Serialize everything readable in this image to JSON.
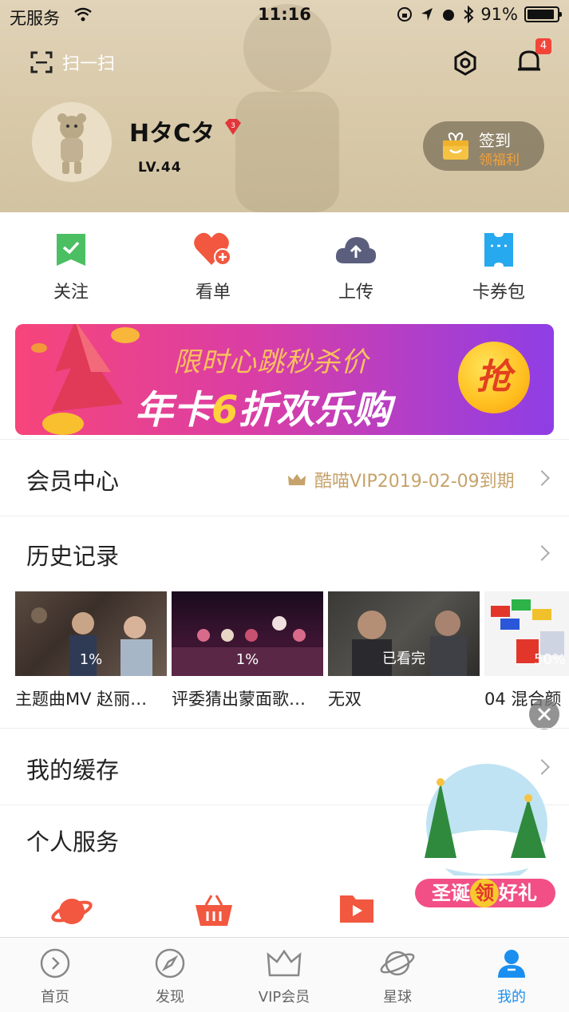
{
  "status_bar": {
    "carrier": "无服务",
    "time": "11:16",
    "battery": "91%",
    "battery_level": 0.91
  },
  "header": {
    "scan_label": "扫一扫",
    "notification_count": "4",
    "username": "HタCタ",
    "vip_badge_level": "3",
    "level": "LV.44",
    "checkin_label": "签到",
    "checkin_sub": "领福利"
  },
  "quick_actions": [
    {
      "label": "关注",
      "icon": "follow-icon"
    },
    {
      "label": "看单",
      "icon": "watchlist-icon"
    },
    {
      "label": "上传",
      "icon": "upload-icon"
    },
    {
      "label": "卡券包",
      "icon": "coupon-icon"
    }
  ],
  "banner": {
    "line1": "限时心跳秒杀价",
    "line2_a": "年卡",
    "line2_num": "6",
    "line2_b": "折欢乐购",
    "grab": "抢"
  },
  "member_center": {
    "title": "会员中心",
    "info": "酷喵VIP2019-02-09到期"
  },
  "history": {
    "title": "历史记录",
    "items": [
      {
        "title": "主题曲MV 赵丽…",
        "progress": "1%"
      },
      {
        "title": "评委猜出蒙面歌…",
        "progress": "1%"
      },
      {
        "title": "无双",
        "progress": "已看完"
      },
      {
        "title": "04 混合颜",
        "progress": "50%"
      }
    ]
  },
  "cache": {
    "title": "我的缓存"
  },
  "services": {
    "title": "个人服务"
  },
  "promo": {
    "text_a": "圣诞",
    "text_b": "领",
    "text_c": "好礼"
  },
  "tabs": [
    {
      "label": "首页",
      "icon": "home-icon"
    },
    {
      "label": "发现",
      "icon": "compass-icon"
    },
    {
      "label": "VIP会员",
      "icon": "crown-icon"
    },
    {
      "label": "星球",
      "icon": "planet-icon"
    },
    {
      "label": "我的",
      "icon": "profile-icon",
      "active": true
    }
  ],
  "colors": {
    "accent": "#1a8ff0",
    "header_bg": "#d8c9a9",
    "vip_gold": "#c6a36b",
    "banner_pink": "#f7457a",
    "banner_purple": "#8e3ee6"
  }
}
